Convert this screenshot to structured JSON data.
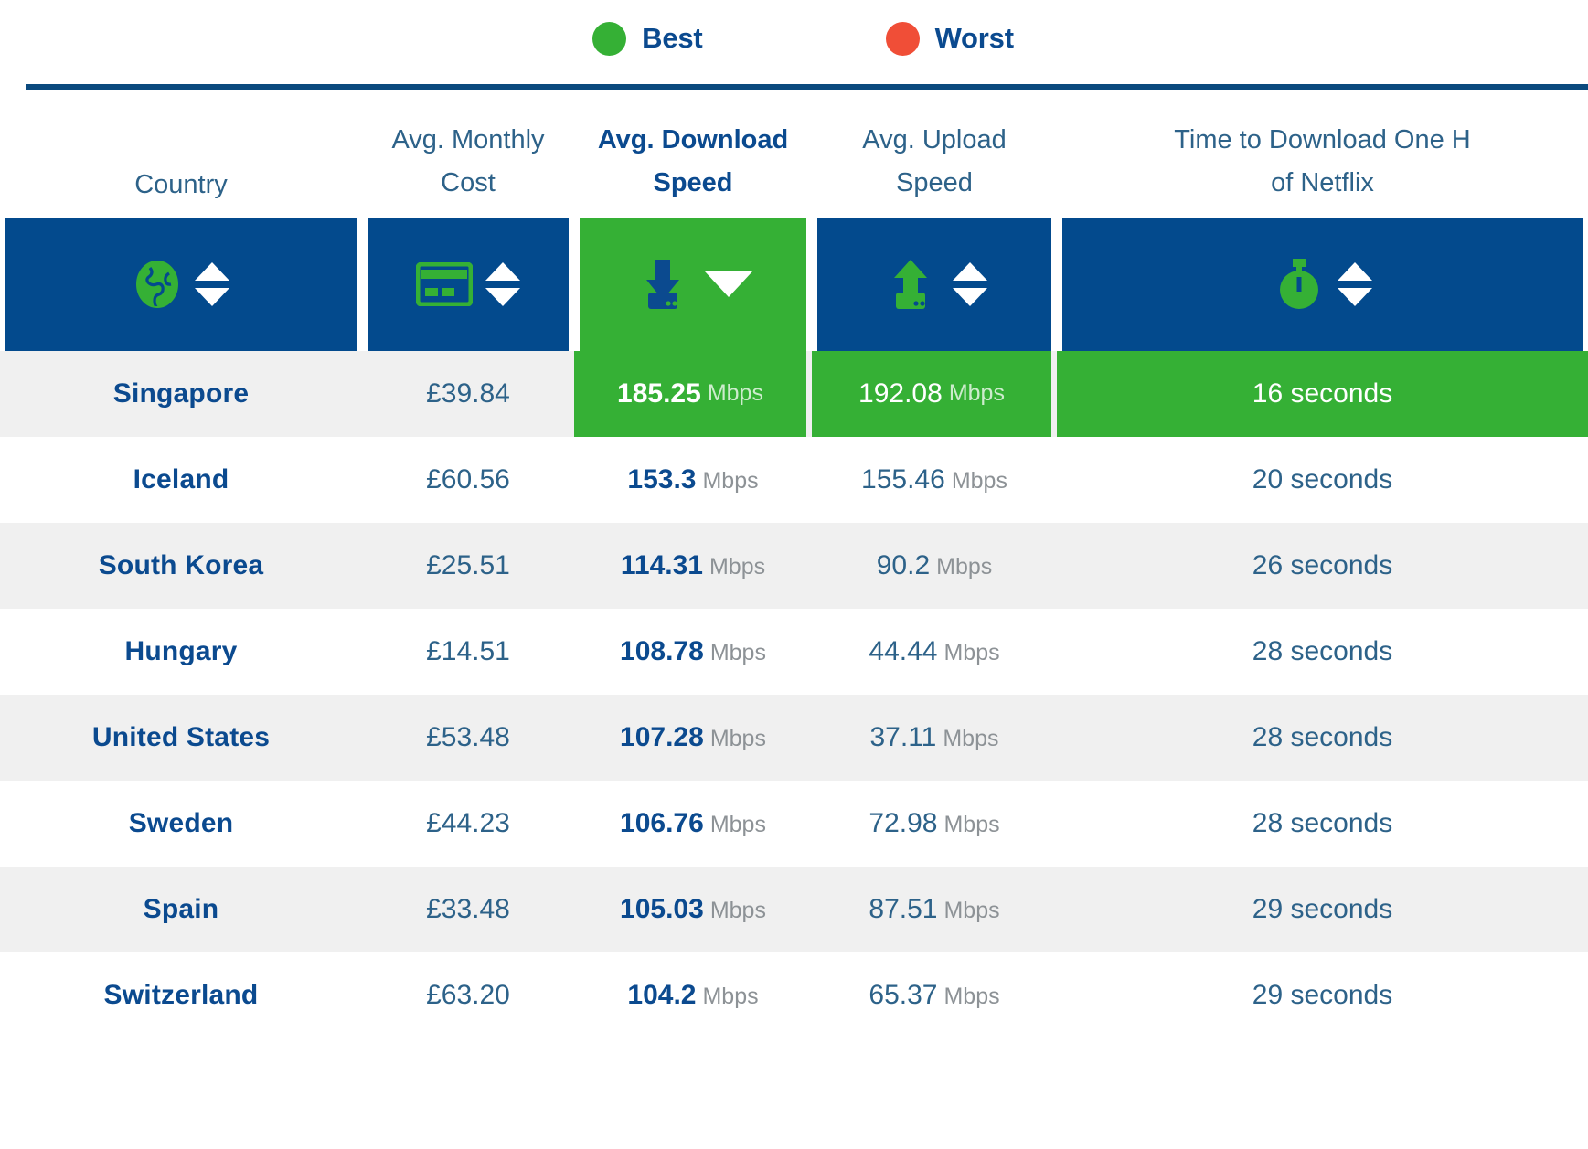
{
  "legend": {
    "best_label": "Best",
    "worst_label": "Worst",
    "best_color": "#35b035",
    "worst_color": "#f04e37"
  },
  "table": {
    "headers": [
      {
        "line1": "Country",
        "line2": "",
        "icon": "globe-icon",
        "sort": "both",
        "active": false
      },
      {
        "line1": "Avg. Monthly",
        "line2": "Cost",
        "icon": "credit-card-icon",
        "sort": "both",
        "active": false
      },
      {
        "line1": "Avg. Download",
        "line2": "Speed",
        "icon": "download-icon",
        "sort": "desc",
        "active": true
      },
      {
        "line1": "Avg. Upload",
        "line2": "Speed",
        "icon": "upload-icon",
        "sort": "both",
        "active": false
      },
      {
        "line1": "Time to Download One H",
        "line2": "of Netflix",
        "icon": "stopwatch-icon",
        "sort": "both",
        "active": false
      }
    ],
    "rows": [
      {
        "country": "Singapore",
        "cost": "£39.84",
        "download": "185.25",
        "download_unit": "Mbps",
        "upload": "192.08",
        "upload_unit": "Mbps",
        "time": "16 seconds",
        "highlight": {
          "download": true,
          "upload": true,
          "time": true
        },
        "shaded": true
      },
      {
        "country": "Iceland",
        "cost": "£60.56",
        "download": "153.3",
        "download_unit": "Mbps",
        "upload": "155.46",
        "upload_unit": "Mbps",
        "time": "20 seconds",
        "highlight": {
          "download": false,
          "upload": false,
          "time": false
        },
        "shaded": false
      },
      {
        "country": "South Korea",
        "cost": "£25.51",
        "download": "114.31",
        "download_unit": "Mbps",
        "upload": "90.2",
        "upload_unit": "Mbps",
        "time": "26 seconds",
        "highlight": {
          "download": false,
          "upload": false,
          "time": false
        },
        "shaded": true
      },
      {
        "country": "Hungary",
        "cost": "£14.51",
        "download": "108.78",
        "download_unit": "Mbps",
        "upload": "44.44",
        "upload_unit": "Mbps",
        "time": "28 seconds",
        "highlight": {
          "download": false,
          "upload": false,
          "time": false
        },
        "shaded": false
      },
      {
        "country": "United States",
        "cost": "£53.48",
        "download": "107.28",
        "download_unit": "Mbps",
        "upload": "37.11",
        "upload_unit": "Mbps",
        "time": "28 seconds",
        "highlight": {
          "download": false,
          "upload": false,
          "time": false
        },
        "shaded": true
      },
      {
        "country": "Sweden",
        "cost": "£44.23",
        "download": "106.76",
        "download_unit": "Mbps",
        "upload": "72.98",
        "upload_unit": "Mbps",
        "time": "28 seconds",
        "highlight": {
          "download": false,
          "upload": false,
          "time": false
        },
        "shaded": false
      },
      {
        "country": "Spain",
        "cost": "£33.48",
        "download": "105.03",
        "download_unit": "Mbps",
        "upload": "87.51",
        "upload_unit": "Mbps",
        "time": "29 seconds",
        "highlight": {
          "download": false,
          "upload": false,
          "time": false
        },
        "shaded": true
      },
      {
        "country": "Switzerland",
        "cost": "£63.20",
        "download": "104.2",
        "download_unit": "Mbps",
        "upload": "65.37",
        "upload_unit": "Mbps",
        "time": "29 seconds",
        "highlight": {
          "download": false,
          "upload": false,
          "time": false
        },
        "shaded": false
      }
    ]
  },
  "colors": {
    "header_blue": "#034a8d",
    "accent_green": "#35b035",
    "text_blue": "#0b4a8f",
    "muted_blue": "#2d6289",
    "unit_gray": "#8d9296",
    "row_shade": "#f0f0f0"
  }
}
